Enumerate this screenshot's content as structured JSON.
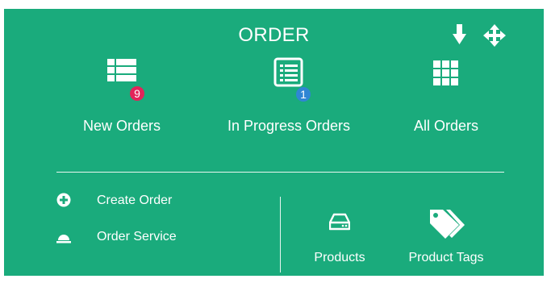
{
  "panel": {
    "title": "ORDER",
    "background_color": "#1aab7c",
    "toolbar": {
      "download_icon": "arrow-down-icon",
      "move_icon": "move-arrows-icon"
    }
  },
  "tiles": [
    {
      "label": "New Orders",
      "icon": "table-list-icon",
      "badge": "9",
      "badge_color": "#e2245a"
    },
    {
      "label": "In Progress Orders",
      "icon": "list-alt-icon",
      "badge": "1",
      "badge_color": "#2f86d4"
    },
    {
      "label": "All Orders",
      "icon": "grid-icon"
    }
  ],
  "actions": [
    {
      "label": "Create Order",
      "icon": "plus-circle-icon"
    },
    {
      "label": "Order Service",
      "icon": "dome-icon"
    }
  ],
  "links": [
    {
      "label": "Products",
      "icon": "drive-icon"
    },
    {
      "label": "Product Tags",
      "icon": "tags-icon"
    }
  ]
}
